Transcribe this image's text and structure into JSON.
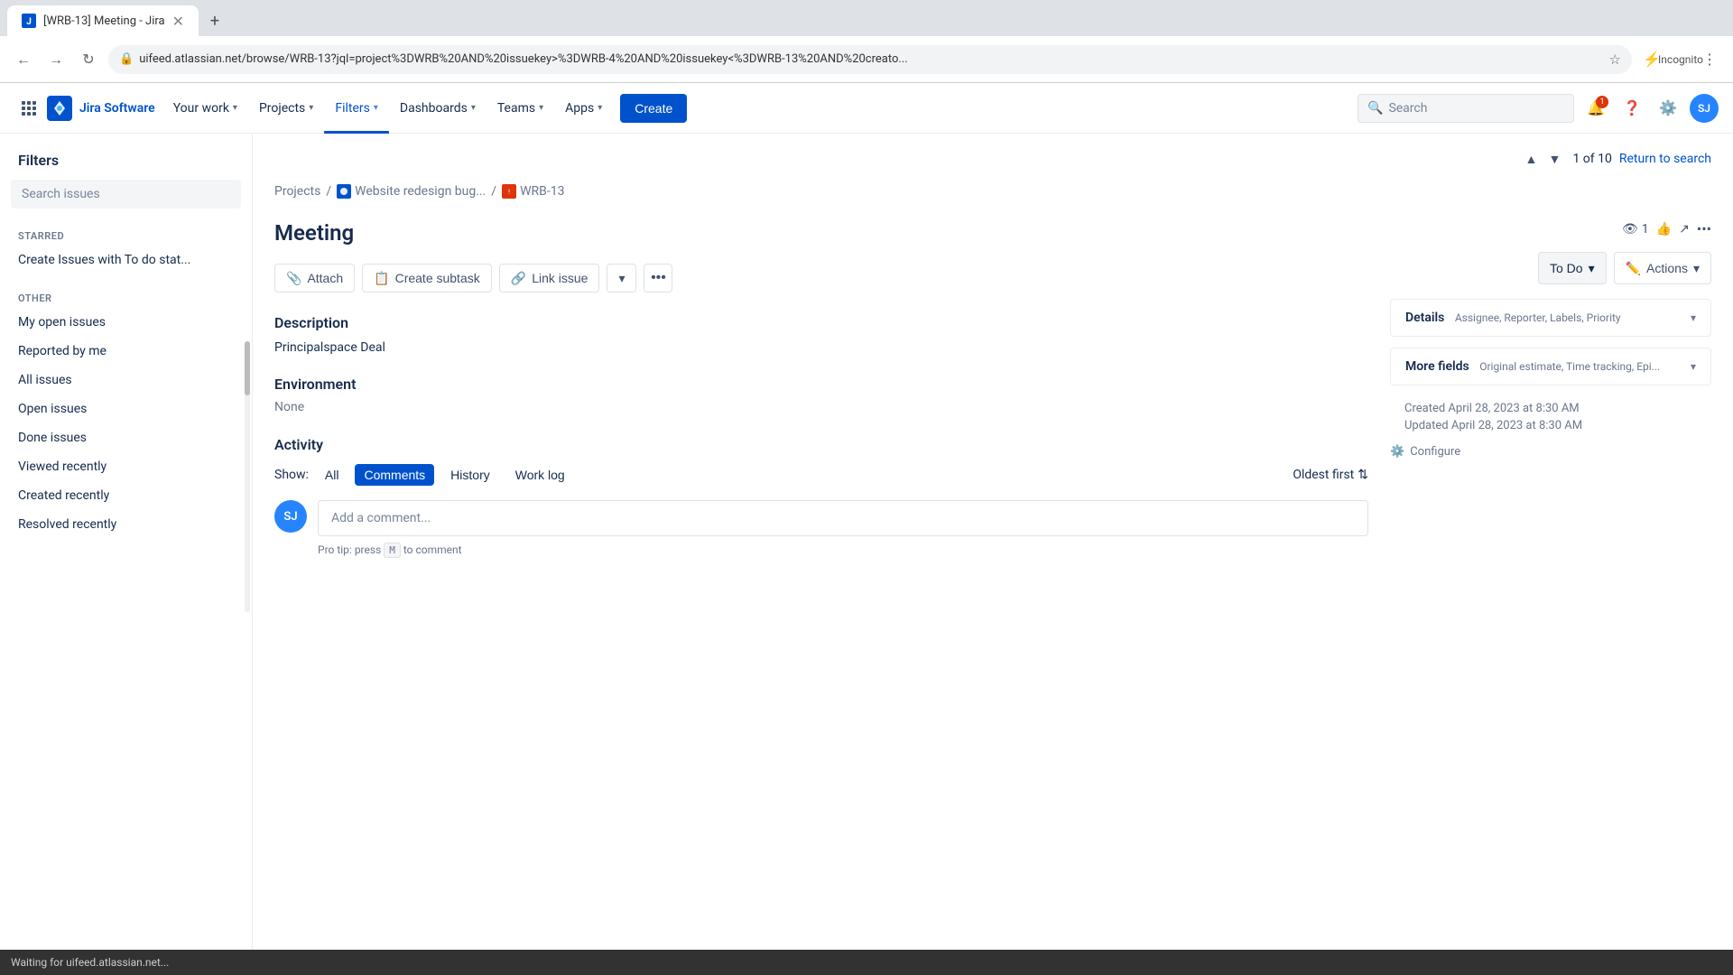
{
  "browser": {
    "tab_title": "[WRB-13] Meeting - Jira",
    "url": "uifeed.atlassian.net/browse/WRB-13?jql=project%3DWRB%20AND%20issuekey>%3DWRB-4%20AND%20issuekey<%3DWRB-13%20AND%20creato...",
    "new_tab_label": "+",
    "incognito_label": "Incognito"
  },
  "nav": {
    "brand": "Jira Software",
    "your_work": "Your work",
    "projects": "Projects",
    "filters": "Filters",
    "dashboards": "Dashboards",
    "teams": "Teams",
    "apps": "Apps",
    "create": "Create",
    "search_placeholder": "Search",
    "notification_count": "1"
  },
  "sidebar": {
    "title": "Filters",
    "search_issues": "Search issues",
    "starred_label": "STARRED",
    "starred_items": [
      {
        "label": "Create Issues with To do stat..."
      }
    ],
    "other_label": "OTHER",
    "other_items": [
      {
        "label": "My open issues"
      },
      {
        "label": "Reported by me"
      },
      {
        "label": "All issues"
      },
      {
        "label": "Open issues"
      },
      {
        "label": "Done issues"
      },
      {
        "label": "Viewed recently"
      },
      {
        "label": "Created recently"
      },
      {
        "label": "Resolved recently"
      }
    ]
  },
  "content": {
    "pagination": "1 of 10",
    "return_search": "Return to search",
    "breadcrumb": {
      "projects": "Projects",
      "project_name": "Website redesign bug...",
      "issue_key": "WRB-13"
    },
    "issue": {
      "title": "Meeting",
      "status": "To Do",
      "actions_label": "Actions",
      "attach_label": "Attach",
      "create_subtask_label": "Create subtask",
      "link_issue_label": "Link issue",
      "description_title": "Description",
      "description_content": "Principalspace Deal",
      "environment_title": "Environment",
      "environment_content": "None",
      "activity_title": "Activity",
      "show_label": "Show:",
      "filter_all": "All",
      "filter_comments": "Comments",
      "filter_history": "History",
      "filter_worklog": "Work log",
      "sort_label": "Oldest first",
      "comment_placeholder": "Add a comment...",
      "pro_tip": "Pro tip:",
      "pro_tip_key": "M",
      "pro_tip_suffix": "to comment",
      "press_label": "press",
      "avatar_initials": "SJ"
    },
    "details": {
      "header": "Details",
      "sub_fields": "Assignee, Reporter, Labels, Priority",
      "more_fields": "More fields",
      "more_sub": "Original estimate, Time tracking, Epi...",
      "created": "Created April 28, 2023 at 8:30 AM",
      "updated": "Updated April 28, 2023 at 8:30 AM",
      "configure_label": "Configure"
    },
    "watch_count": "1",
    "like_count": ""
  },
  "status_bar": {
    "message": "Waiting for uifeed.atlassian.net..."
  }
}
